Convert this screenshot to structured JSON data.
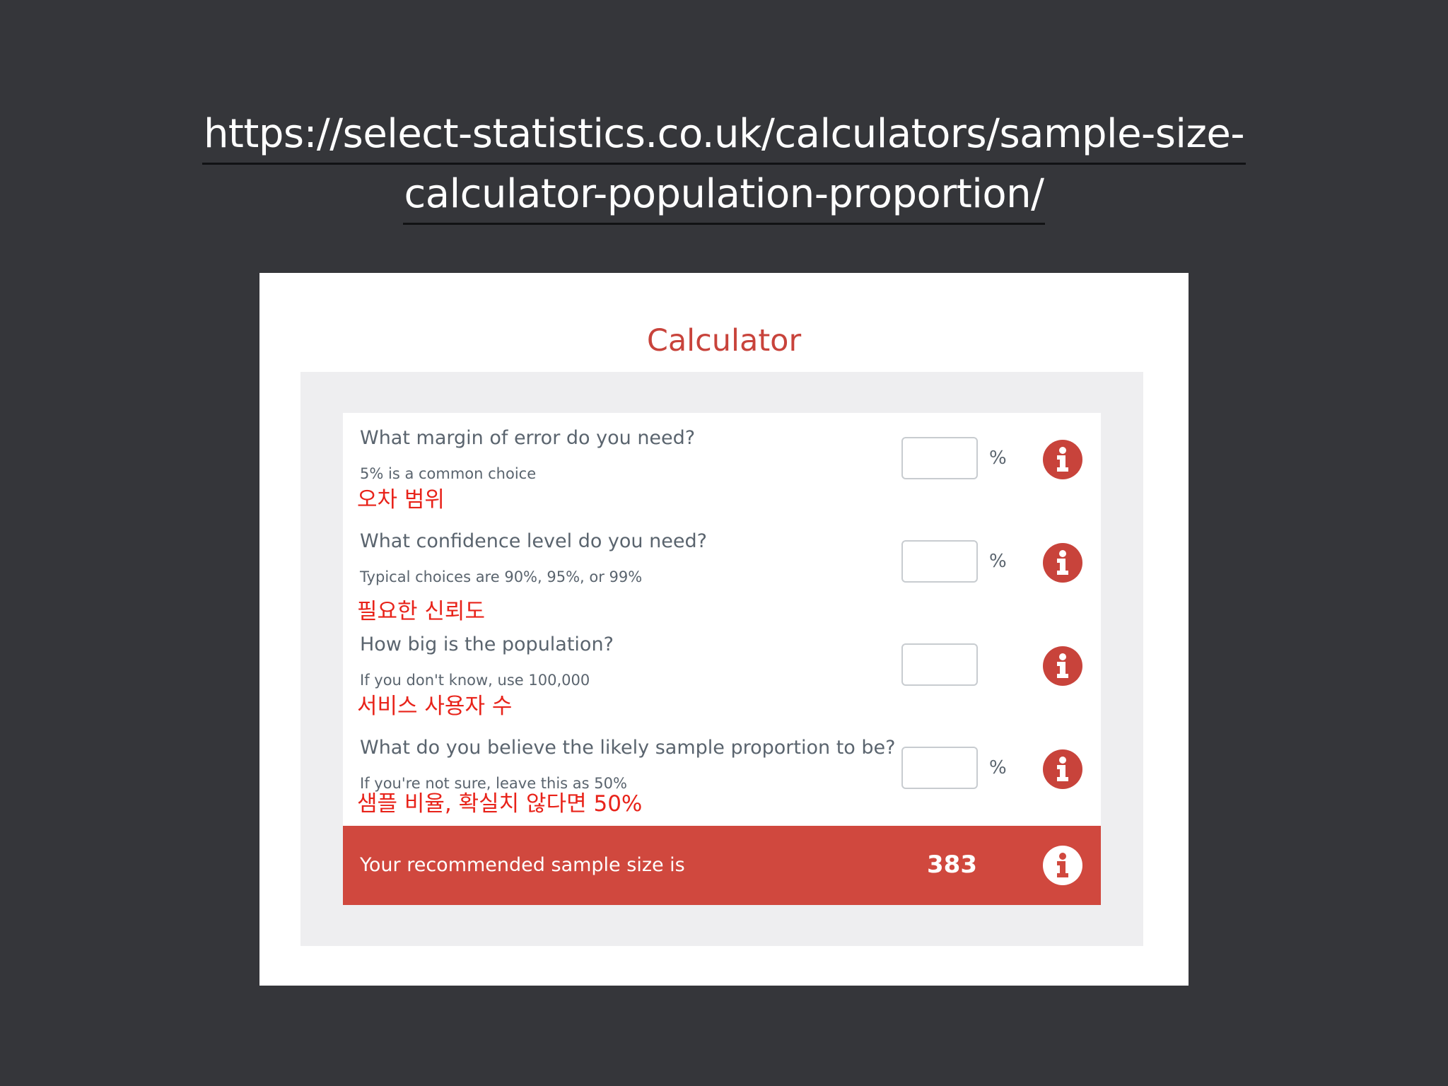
{
  "heading": {
    "url_line1": "https://select-statistics.co.uk/calculators/sample-size-",
    "url_line2": "calculator-population-proportion/"
  },
  "calculator": {
    "title": "Calculator",
    "questions": [
      {
        "label": "What margin of error do you need?",
        "hint": "5% is a common choice",
        "note": "오차 범위",
        "value": "",
        "unit": "%"
      },
      {
        "label": "What confidence level do you need?",
        "hint": "Typical choices are 90%, 95%, or 99%",
        "note": "필요한 신뢰도",
        "value": "",
        "unit": "%"
      },
      {
        "label": "How big is the population?",
        "hint": "If you don't know, use 100,000",
        "note": "서비스 사용자 수",
        "value": "",
        "unit": ""
      },
      {
        "label": "What do you believe the likely sample proportion to be?",
        "hint": "If you're not sure, leave this as 50%",
        "note": "샘플 비율, 확실치 않다면 50%",
        "value": "",
        "unit": "%"
      }
    ],
    "result": {
      "label": "Your recommended sample size is",
      "value": "383"
    }
  },
  "icons": {
    "question_info": "info-icon",
    "result_info": "info-icon"
  },
  "colors": {
    "background": "#35363a",
    "accent": "#c8433b",
    "result_bar": "#d0483e",
    "note_text": "#e8231a",
    "panel_gray": "#eeeef0"
  }
}
